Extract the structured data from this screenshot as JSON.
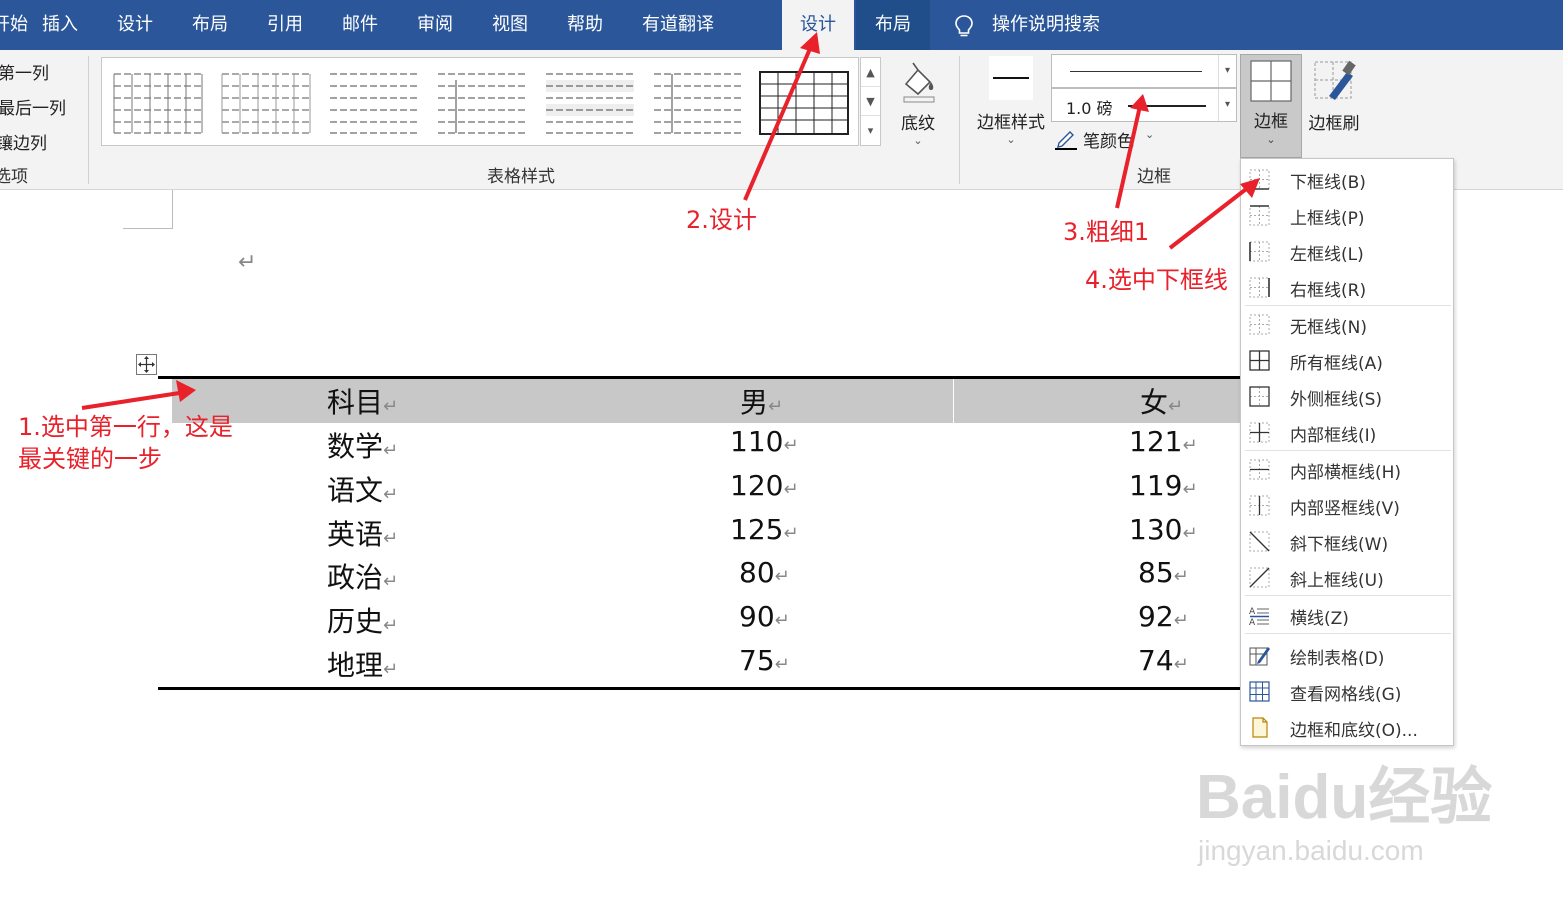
{
  "ribbon_tabs": {
    "partial_left": "开始",
    "insert": "插入",
    "design": "设计",
    "layout": "布局",
    "references": "引用",
    "mailings": "邮件",
    "review": "审阅",
    "view": "视图",
    "help": "帮助",
    "youdao": "有道翻译",
    "table_design": "设计",
    "table_layout": "布局",
    "search": "操作说明搜索"
  },
  "style_options": {
    "first_column": "第一列",
    "last_column": "最后一列",
    "banded_columns": "镶边列",
    "group_label": "选项"
  },
  "table_styles": {
    "group_label": "表格样式",
    "shading_label": "底纹"
  },
  "borders_group": {
    "border_styles_label": "边框样式",
    "line_weight": "1.0 磅",
    "pen_color_label": "笔颜色",
    "group_label": "边框",
    "borders_label": "边框",
    "border_painter_label": "边框刷"
  },
  "border_menu": [
    {
      "label": "下框线(B)",
      "icon": "border-bottom-icon"
    },
    {
      "label": "上框线(P)",
      "icon": "border-top-icon"
    },
    {
      "label": "左框线(L)",
      "icon": "border-left-icon"
    },
    {
      "label": "右框线(R)",
      "icon": "border-right-icon"
    },
    {
      "label": "无框线(N)",
      "icon": "border-none-icon"
    },
    {
      "label": "所有框线(A)",
      "icon": "border-all-icon"
    },
    {
      "label": "外侧框线(S)",
      "icon": "border-outside-icon"
    },
    {
      "label": "内部框线(I)",
      "icon": "border-inside-icon"
    },
    {
      "label": "内部横框线(H)",
      "icon": "border-inside-horizontal-icon"
    },
    {
      "label": "内部竖框线(V)",
      "icon": "border-inside-vertical-icon"
    },
    {
      "label": "斜下框线(W)",
      "icon": "diagonal-down-icon"
    },
    {
      "label": "斜上框线(U)",
      "icon": "diagonal-up-icon"
    },
    {
      "label": "横线(Z)",
      "icon": "horizontal-line-icon"
    },
    {
      "label": "绘制表格(D)",
      "icon": "draw-table-icon"
    },
    {
      "label": "查看网格线(G)",
      "icon": "gridlines-icon"
    },
    {
      "label": "边框和底纹(O)...",
      "icon": "borders-shading-icon"
    }
  ],
  "table": {
    "header": [
      "科目",
      "男",
      "女"
    ],
    "rows": [
      [
        "数学",
        "110",
        "121"
      ],
      [
        "语文",
        "120",
        "119"
      ],
      [
        "英语",
        "125",
        "130"
      ],
      [
        "政治",
        "80",
        "85"
      ],
      [
        "历史",
        "90",
        "92"
      ],
      [
        "地理",
        "75",
        "74"
      ]
    ],
    "return_mark": "↵"
  },
  "annotations": {
    "step1_line1": "1.选中第一行，这是",
    "step1_line2": "最关键的一步",
    "step2": "2.设计",
    "step3": "3.粗细1",
    "step4": "4.选中下框线"
  },
  "watermark": {
    "main": "Baidu经验",
    "sub": "jingyan.baidu.com"
  },
  "colors": {
    "ribbon_blue": "#2b579a",
    "annotation_red": "#e8212b",
    "header_gray": "#c8c8c8"
  }
}
